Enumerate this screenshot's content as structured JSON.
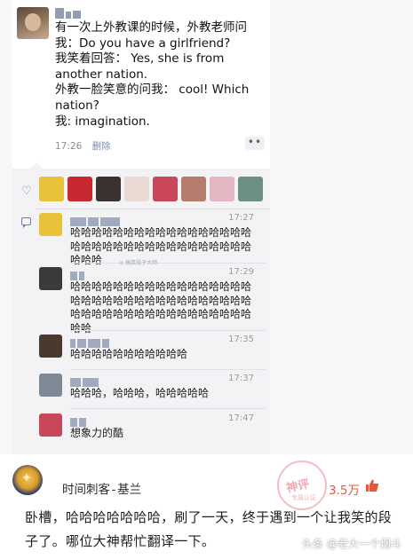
{
  "post": {
    "text": "有一次上外教课的时候，外教老师问我：Do you have a girlfriend?\n我笑着回答： Yes, she is from another nation.\n外教一脸笑意的问我： cool! Which nation?\n我: imagination.",
    "time": "17:26",
    "delete_label": "删除",
    "more_label": "••"
  },
  "likes": {
    "avatars": [
      {
        "icon": "minion-avatar",
        "color": "#e8c23a"
      },
      {
        "icon": "red-logo-avatar",
        "color": "#c8282f"
      },
      {
        "icon": "dark-portrait-avatar",
        "color": "#3b3331"
      },
      {
        "icon": "cartoon-girl-avatar",
        "color": "#e9dad3"
      },
      {
        "icon": "red-flower-avatar",
        "color": "#c9475a"
      },
      {
        "icon": "girl-portrait-avatar",
        "color": "#b57d6d"
      },
      {
        "icon": "pink-avatar",
        "color": "#e3b6c2"
      },
      {
        "icon": "outdoor-portrait-avatar",
        "color": "#6c8f84"
      }
    ]
  },
  "comments": [
    {
      "avatar_icon": "minion-avatar",
      "avatar_color": "#e8c23a",
      "time": "17:27",
      "text": "哈哈哈哈哈哈哈哈哈哈哈哈哈哈哈哈哈哈哈哈哈哈哈哈哈哈哈哈哈哈哈哈哈哈哈哈哈"
    },
    {
      "avatar_icon": "dark-portrait-avatar",
      "avatar_color": "#3a3a3a",
      "time": "17:29",
      "text": "哈哈哈哈哈哈哈哈哈哈哈哈哈哈哈哈哈哈哈哈哈哈哈哈哈哈哈哈哈哈哈哈哈哈哈哈哈哈哈哈哈哈哈哈哈哈哈哈哈哈哈哈哈"
    },
    {
      "avatar_icon": "dark-portrait-avatar",
      "avatar_color": "#4a3a2e",
      "time": "17:35",
      "text": "哈哈哈哈哈哈哈哈哈哈哈"
    },
    {
      "avatar_icon": "landscape-avatar",
      "avatar_color": "#7d8a95",
      "time": "17:37",
      "text": "哈哈哈，哈哈哈，哈哈哈哈哈"
    },
    {
      "avatar_icon": "red-flower-avatar",
      "avatar_color": "#c9475a",
      "time": "17:47",
      "text": "想象力的酷"
    }
  ],
  "watermark_small": "◎ 搞笑段子大师",
  "reply": {
    "user_name": "时间刺客-基兰",
    "like_count": "3.5万",
    "text": "卧槽，哈哈哈哈哈哈哈，刷了一天，终于遇到一个让我笑的段子了。哪位大神帮忙翻译一下。",
    "stamp_text": "神评",
    "stamp_sub": "专属认证"
  },
  "source_label": "头条 @老大一个烟斗",
  "colors": {
    "accent_link": "#7d8bb0",
    "like_red": "#e15a3d"
  }
}
